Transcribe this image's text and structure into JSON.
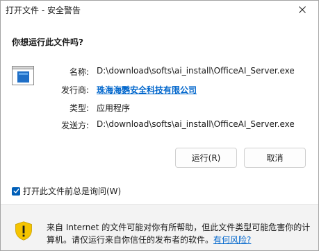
{
  "window": {
    "title": "打开文件 - 安全警告"
  },
  "question": "你想运行此文件吗?",
  "file_info": {
    "name_label": "名称:",
    "name_value": "D:\\download\\softs\\ai_install\\OfficeAI_Server.exe",
    "publisher_label": "发行商:",
    "publisher_value": "珠海海鹦安全科技有限公司",
    "type_label": "类型:",
    "type_value": "应用程序",
    "from_label": "发送方:",
    "from_value": "D:\\download\\softs\\ai_install\\OfficeAI_Server.exe"
  },
  "buttons": {
    "run_label": "运行(R)",
    "cancel_label": "取消"
  },
  "checkbox": {
    "label": "打开此文件前总是询问(W)",
    "checked": true
  },
  "footer": {
    "warning_text": "来自 Internet 的文件可能对你有所帮助，但此文件类型可能危害你的计算机。请仅运行来自你信任的发布者的软件。",
    "risk_link": "有何风险?"
  },
  "colors": {
    "accent": "#005fb8",
    "link": "#0066cc",
    "shield_yellow": "#f5c400"
  },
  "icons": {
    "close": "close-icon",
    "file": "exe-file-icon",
    "warning": "shield-warning-icon",
    "check": "checkmark-icon"
  }
}
